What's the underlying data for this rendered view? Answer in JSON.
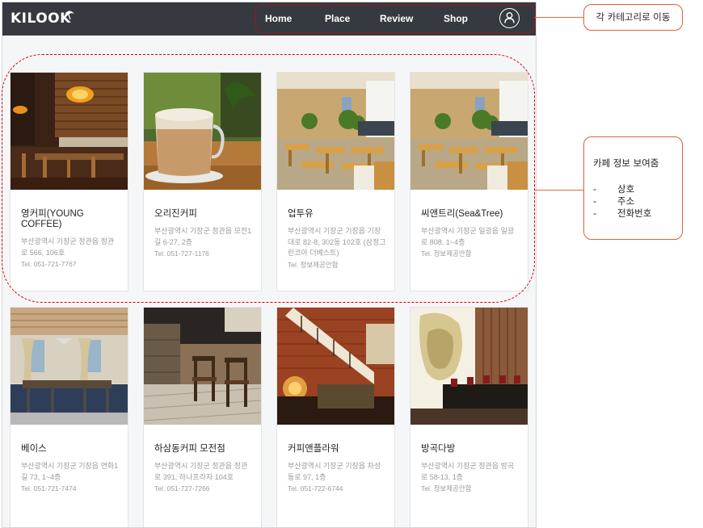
{
  "app": {
    "logo": "KILOOK"
  },
  "nav": {
    "items": [
      {
        "label": "Home"
      },
      {
        "label": "Place"
      },
      {
        "label": "Review"
      },
      {
        "label": "Shop"
      }
    ]
  },
  "cards": [
    {
      "name": "영커피(YOUNG COFFEE)",
      "address": "부산광역시 기장군 정관읍 정관로 566, 106호",
      "tel": "Tel. 051-721-7767"
    },
    {
      "name": "오리진커피",
      "address": "부산광역시 기장군 정관읍 모전1길 6-27, 2층",
      "tel": "Tel. 051-727-1176"
    },
    {
      "name": "업투유",
      "address": "부산광역시 기장군 기장읍 기장대로 82-8, 302동 102호 (삼정그린코아 더베스트)",
      "tel": "Tel. 정보제공안함"
    },
    {
      "name": "씨앤트리(Sea&Tree)",
      "address": "부산광역시 기장군 일광읍 일광로 808, 1~4층",
      "tel": "Tel. 정보제공안함"
    },
    {
      "name": "베이스",
      "address": "부산광역시 기장군 기장읍 연화1길 73, 1~4층",
      "tel": "Tel. 051-721-7474"
    },
    {
      "name": "하삼동커피 모전점",
      "address": "부산광역시 기장군 정관읍 정관로 391, 하나프라자 104호",
      "tel": "Tel. 051-727-7266"
    },
    {
      "name": "커피앤플라워",
      "address": "부산광역시 기장군 기장읍 차성동로 97, 1층",
      "tel": "Tel. 051-722-6744"
    },
    {
      "name": "방곡다방",
      "address": "부산광역시 기장군 정관읍 방곡로 58-13, 1층",
      "tel": "Tel. 정보제공안함"
    }
  ],
  "annotations": {
    "nav_note": "각 카테고리로 이동",
    "card_note": {
      "title": "카페 정보 보여줌",
      "items": [
        "상호",
        "주소",
        "전화번호"
      ]
    },
    "color": "#d9000a"
  },
  "colors": {
    "navbar": "#363a40",
    "background": "#f5f6f8"
  }
}
